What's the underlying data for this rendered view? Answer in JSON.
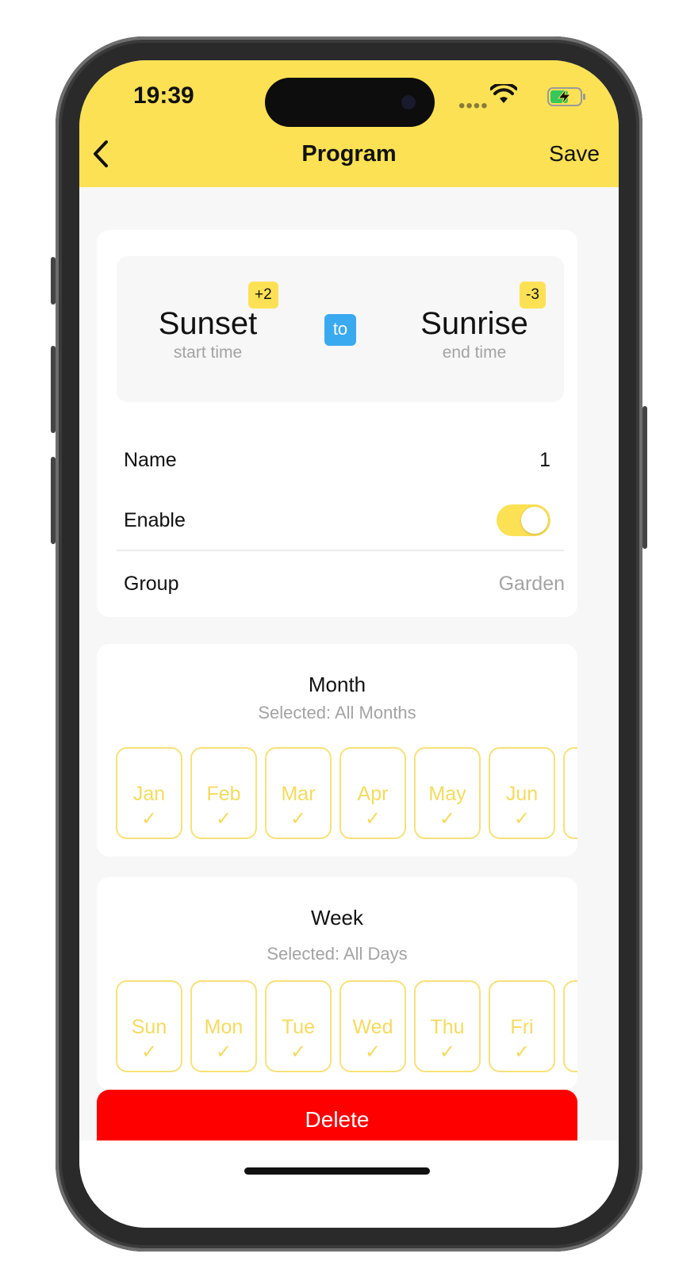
{
  "status_bar": {
    "time": "19:39",
    "signal_dots": "••••",
    "icons": [
      "wifi-icon",
      "battery-charging-icon"
    ]
  },
  "nav": {
    "back_icon": "chevron-left-icon",
    "title": "Program",
    "save_label": "Save"
  },
  "schedule": {
    "start": {
      "value": "Sunset",
      "label": "start time",
      "offset": "+2"
    },
    "connector": "to",
    "end": {
      "value": "Sunrise",
      "label": "end time",
      "offset": "-3"
    }
  },
  "settings": {
    "name_label": "Name",
    "name_value": "1",
    "enable_label": "Enable",
    "enabled": true,
    "group_label": "Group",
    "group_value": "Garden"
  },
  "month": {
    "title": "Month",
    "selected": "Selected: All Months",
    "items": [
      {
        "label": "Jan",
        "check": "✓"
      },
      {
        "label": "Feb",
        "check": "✓"
      },
      {
        "label": "Mar",
        "check": "✓"
      },
      {
        "label": "Apr",
        "check": "✓"
      },
      {
        "label": "May",
        "check": "✓"
      },
      {
        "label": "Jun",
        "check": "✓"
      }
    ]
  },
  "week": {
    "title": "Week",
    "selected": "Selected: All Days",
    "items": [
      {
        "label": "Sun",
        "check": "✓"
      },
      {
        "label": "Mon",
        "check": "✓"
      },
      {
        "label": "Tue",
        "check": "✓"
      },
      {
        "label": "Wed",
        "check": "✓"
      },
      {
        "label": "Thu",
        "check": "✓"
      },
      {
        "label": "Fri",
        "check": "✓"
      }
    ]
  },
  "actions": {
    "delete_label": "Delete"
  },
  "colors": {
    "accent": "#fce155",
    "chip_border": "#f7e17a",
    "to_badge": "#3aaaf0",
    "danger": "#ff0000"
  }
}
